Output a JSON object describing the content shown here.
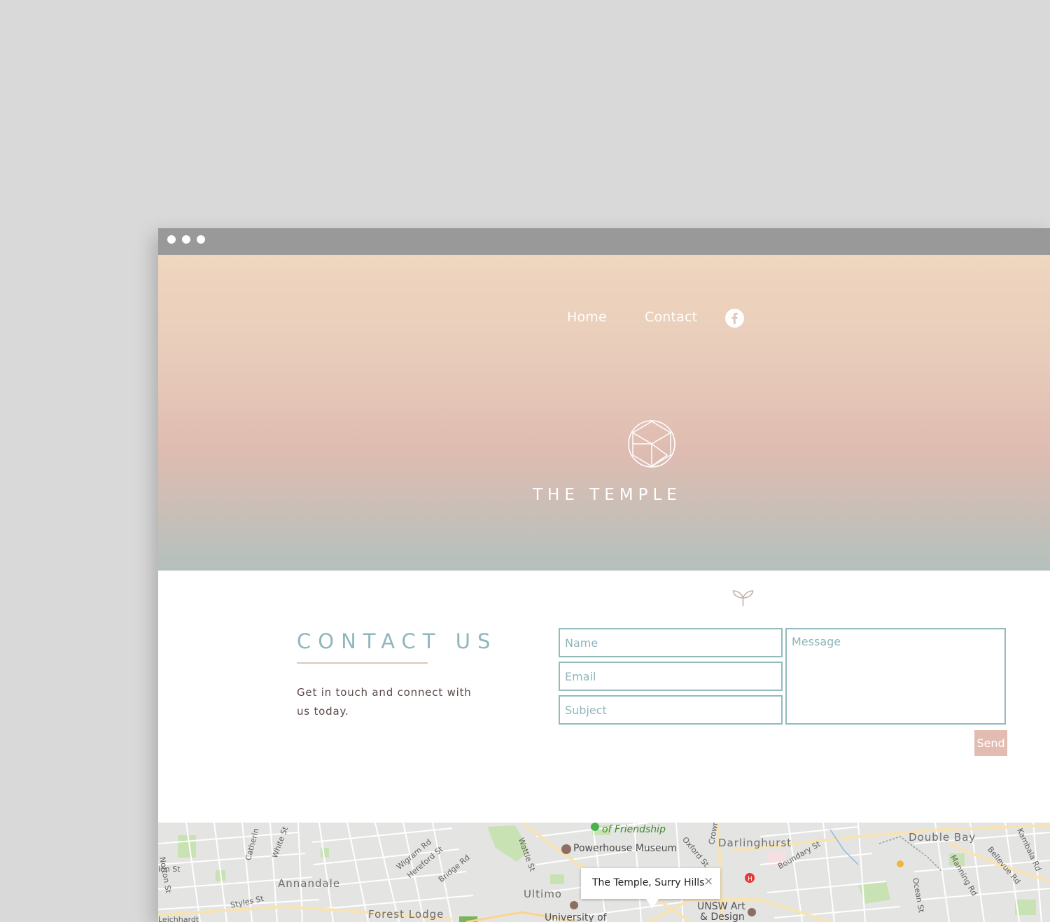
{
  "nav": {
    "home_label": "Home",
    "contact_label": "Contact",
    "social_icon": "facebook-icon"
  },
  "brand": {
    "name": "THE TEMPLE",
    "logo_icon": "geometric-cube-logo"
  },
  "contact": {
    "title": "CONTACT US",
    "copy": "Get in touch and connect with us today.",
    "name_placeholder": "Name",
    "email_placeholder": "Email",
    "subject_placeholder": "Subject",
    "message_placeholder": "Message",
    "send_label": "Send"
  },
  "map": {
    "info_window": "The Temple, Surry Hills",
    "close_label": "×",
    "labels": {
      "chinese_garden": "of Friendship",
      "powerhouse": "Powerhouse Museum",
      "darlinghurst": "Darlinghurst",
      "double_bay": "Double Bay",
      "annandale": "Annandale",
      "ultimo": "Ultimo",
      "forest_lodge": "Forest Lodge",
      "university": "University of",
      "unsw": "UNSW Art",
      "design": "& Design",
      "norton": "Norton St",
      "catherine": "Catherin",
      "white": "White St",
      "wigram": "Wigram Rd",
      "hereford": "Hereford St",
      "bridge": "Bridge Rd",
      "wattle": "Wattle St",
      "oxford": "Oxford St",
      "crown": "Crown",
      "boundary": "Boundary St",
      "ocean": "Ocean St",
      "manning": "Manning Rd",
      "bellevue": "Bellevue Rd",
      "kambala": "Kambala Rd",
      "styles": "Styles St",
      "leichhardt": "Leichhardt",
      "ross": "ion St"
    }
  },
  "colors": {
    "accent_teal": "#8fb6bb",
    "send_pink": "#e3bcb1",
    "hero_top": "#efd6bf",
    "hero_bottom": "#b4c0be"
  }
}
